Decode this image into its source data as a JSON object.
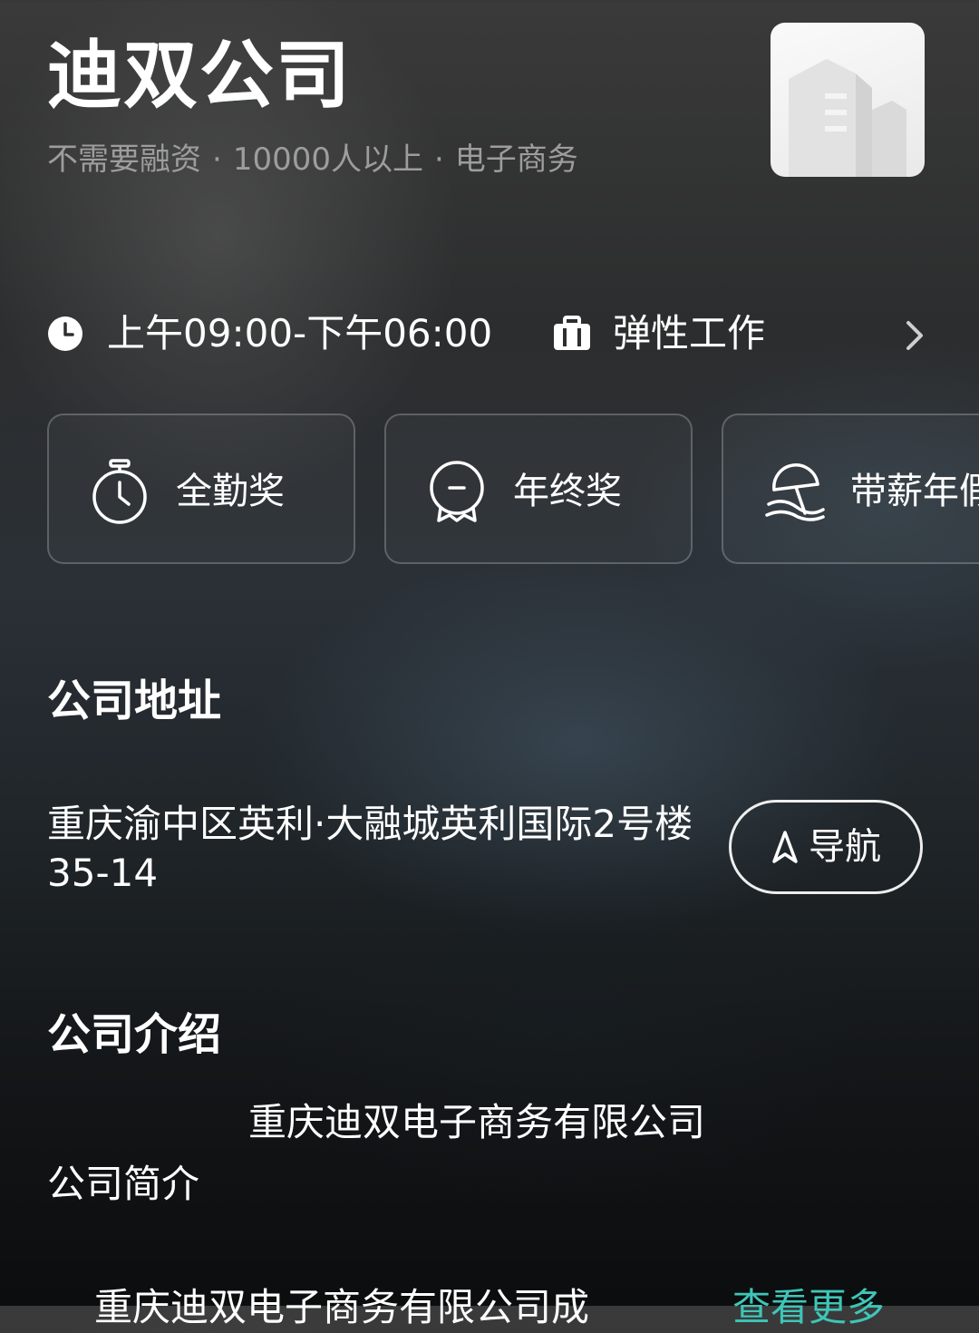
{
  "company": {
    "name": "迪双公司",
    "funding": "不需要融资",
    "size": "10000人以上",
    "industry": "电子商务",
    "separator": "·",
    "logo_icon": "building-icon"
  },
  "work_info": {
    "hours": "上午09:00-下午06:00",
    "mode": "弹性工作",
    "clock_icon": "clock-icon",
    "mode_icon": "briefcase-icon",
    "more_icon": "chevron-right-icon"
  },
  "benefits": [
    {
      "label": "全勤奖",
      "icon": "stopwatch-icon"
    },
    {
      "label": "年终奖",
      "icon": "medal-icon"
    },
    {
      "label": "带薪年假",
      "icon": "beach-umbrella-icon"
    }
  ],
  "address_section": {
    "title": "公司地址",
    "address": "重庆渝中区英利·大融城英利国际2号楼35-14",
    "nav_label": "导航",
    "nav_icon": "navigation-icon"
  },
  "intro_section": {
    "title": "公司介绍",
    "company_full_name": "重庆迪双电子商务有限公司",
    "subheading": "公司简介",
    "snippet": "重庆迪双电子商务有限公司成",
    "more_label": "查看更多"
  },
  "colors": {
    "accent": "#3ec6b8",
    "meta_text": "#9d9d9d",
    "text": "#ffffff"
  }
}
